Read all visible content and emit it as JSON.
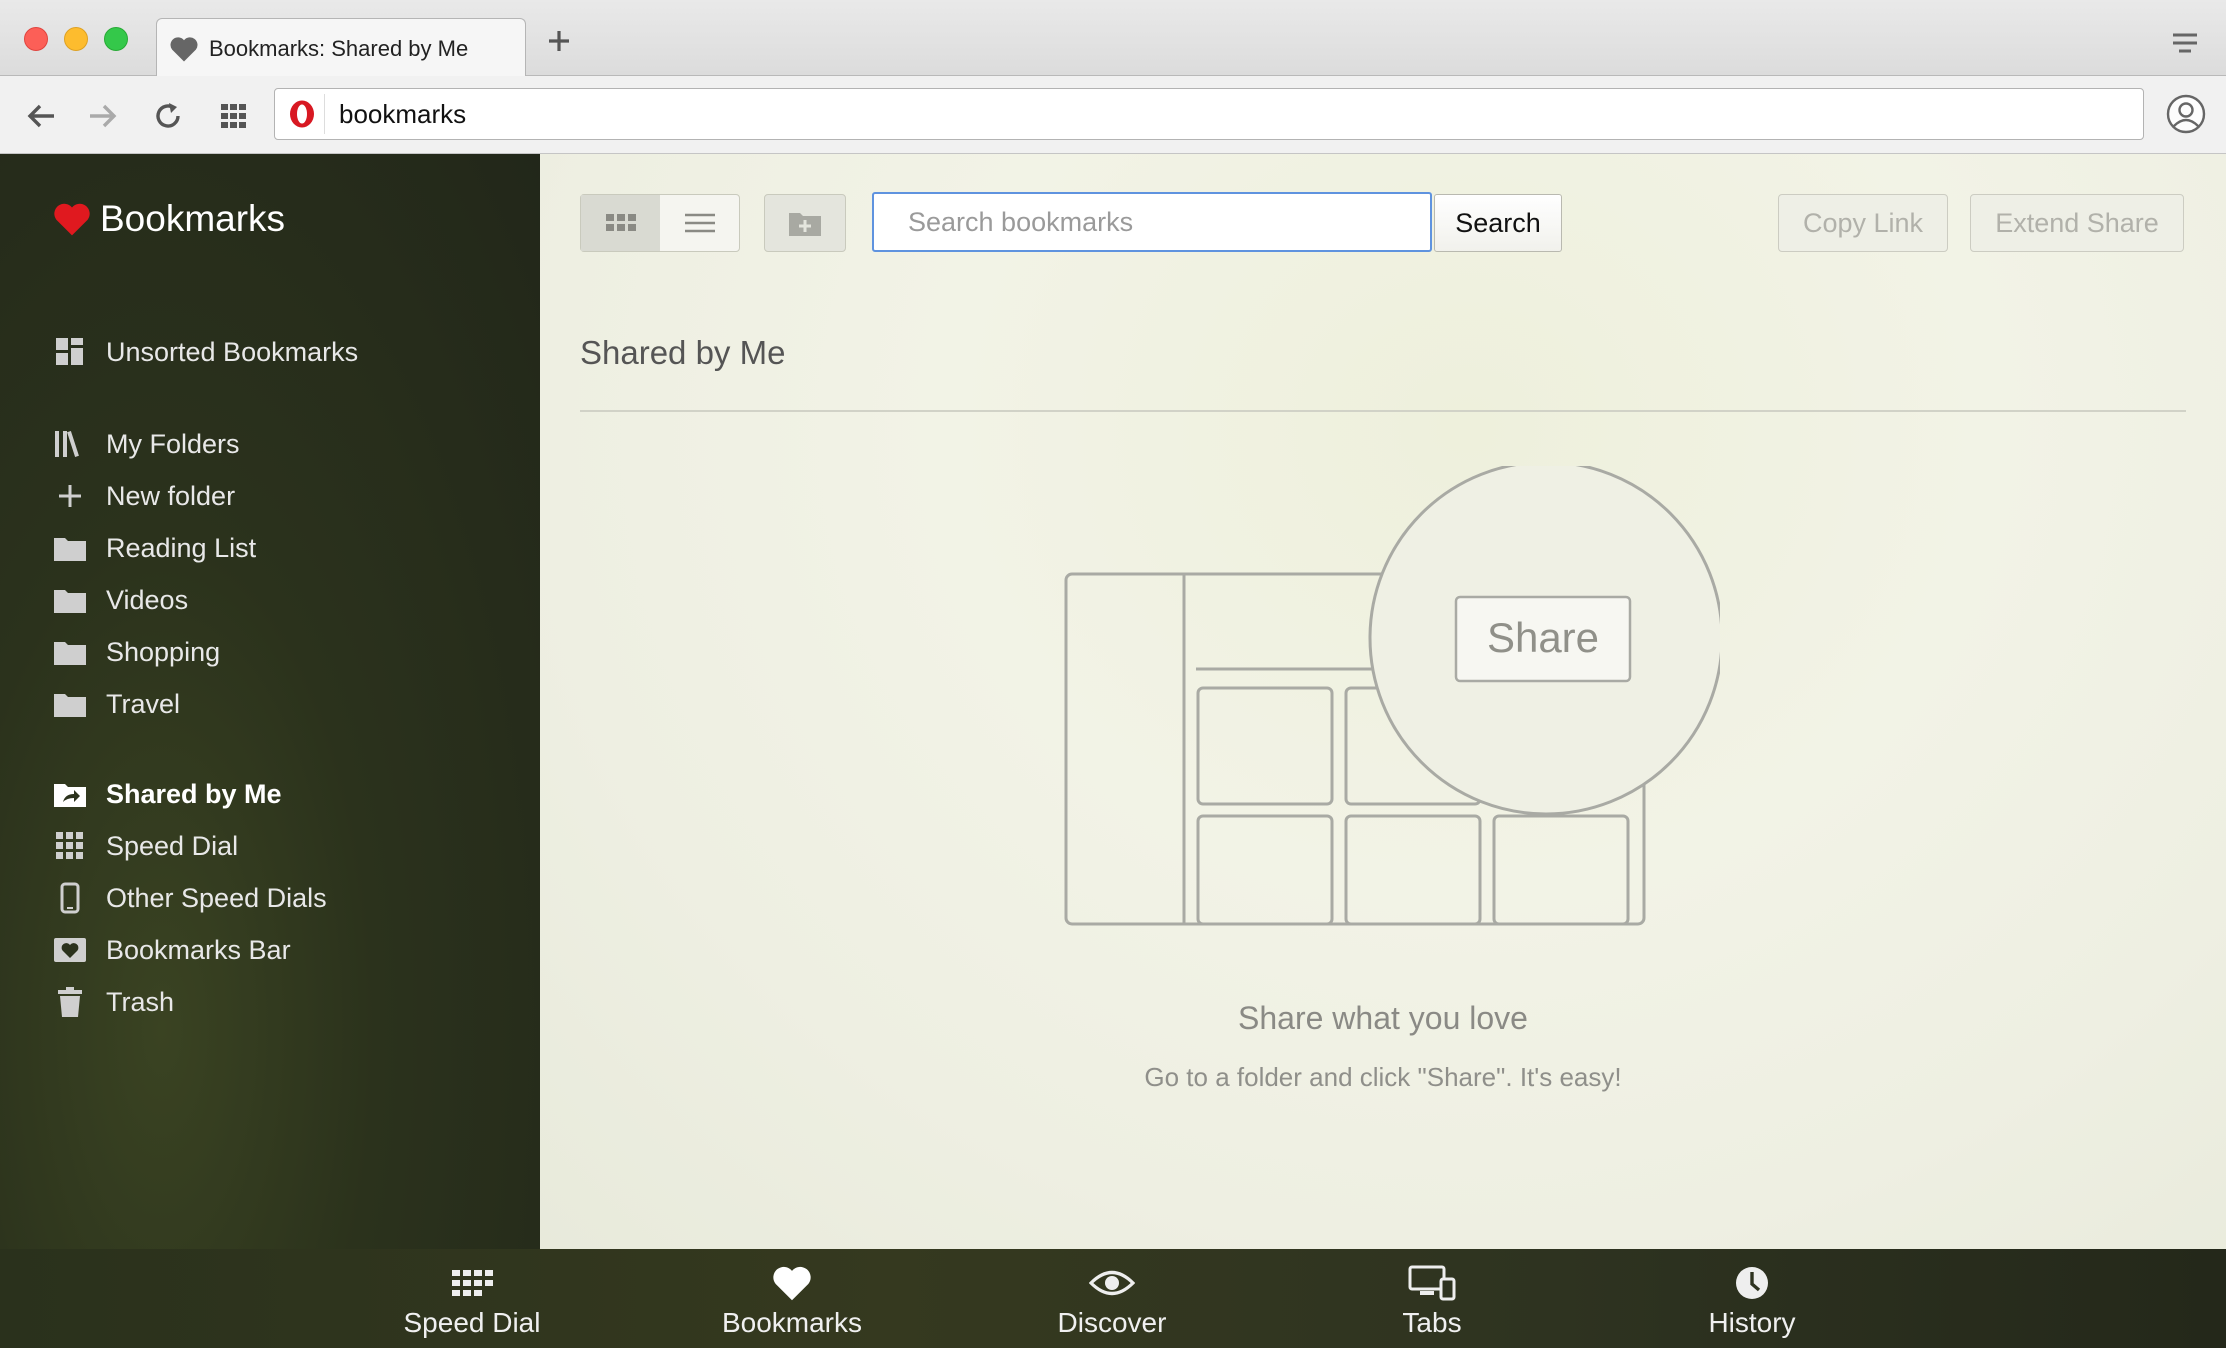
{
  "window": {
    "tab_title": "Bookmarks: Shared by Me",
    "address": "bookmarks"
  },
  "sidebar": {
    "title": "Bookmarks",
    "items": [
      {
        "label": "Unsorted Bookmarks",
        "icon": "unsorted-icon"
      },
      {
        "label": "My Folders",
        "icon": "library-icon"
      },
      {
        "label": "New folder",
        "icon": "plus-icon"
      },
      {
        "label": "Reading List",
        "icon": "folder-icon"
      },
      {
        "label": "Videos",
        "icon": "folder-icon"
      },
      {
        "label": "Shopping",
        "icon": "folder-icon"
      },
      {
        "label": "Travel",
        "icon": "folder-icon"
      },
      {
        "label": "Shared by Me",
        "icon": "shared-folder-icon",
        "active": true
      },
      {
        "label": "Speed Dial",
        "icon": "grid-icon"
      },
      {
        "label": "Other Speed Dials",
        "icon": "phone-icon"
      },
      {
        "label": "Bookmarks Bar",
        "icon": "heart-box-icon"
      },
      {
        "label": "Trash",
        "icon": "trash-icon"
      }
    ]
  },
  "toolbar": {
    "search_placeholder": "Search bookmarks",
    "search_label": "Search",
    "copy_link_label": "Copy Link",
    "extend_share_label": "Extend Share"
  },
  "main": {
    "section_title": "Shared by Me",
    "illustration_button": "Share",
    "empty_title": "Share what you love",
    "empty_subtitle": "Go to a folder and click \"Share\". It's easy!"
  },
  "bottom_nav": [
    {
      "label": "Speed Dial",
      "icon": "speed-dial-icon"
    },
    {
      "label": "Bookmarks",
      "icon": "heart-icon"
    },
    {
      "label": "Discover",
      "icon": "eye-icon"
    },
    {
      "label": "Tabs",
      "icon": "devices-icon"
    },
    {
      "label": "History",
      "icon": "clock-icon"
    }
  ],
  "colors": {
    "accent_red": "#e0191f",
    "search_focus": "#5f93df",
    "sidebar_bg": "#2b321c"
  }
}
